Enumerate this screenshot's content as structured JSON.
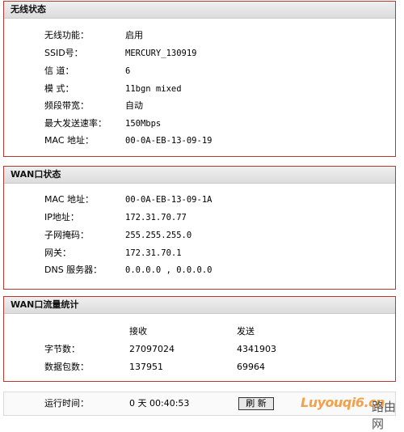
{
  "wireless": {
    "title": "无线状态",
    "rows": [
      {
        "label": "无线功能：",
        "value": "启用"
      },
      {
        "label": "SSID号：",
        "value": "MERCURY_130919"
      },
      {
        "label": "信 道：",
        "value": "6"
      },
      {
        "label": "模 式：",
        "value": "11bgn mixed"
      },
      {
        "label": "频段带宽：",
        "value": "自动"
      },
      {
        "label": "最大发送速率：",
        "value": "150Mbps"
      },
      {
        "label": "MAC 地址：",
        "value": "00-0A-EB-13-09-19"
      }
    ]
  },
  "wan": {
    "title": "WAN口状态",
    "rows": [
      {
        "label": "MAC 地址：",
        "value": "00-0A-EB-13-09-1A"
      },
      {
        "label": "IP地址：",
        "value": "172.31.70.77"
      },
      {
        "label": "子网掩码：",
        "value": "255.255.255.0"
      },
      {
        "label": "网关：",
        "value": "172.31.70.1"
      },
      {
        "label": "DNS 服务器：",
        "value": "0.0.0.0 , 0.0.0.0"
      }
    ]
  },
  "traffic": {
    "title": "WAN口流量统计",
    "col_receive": "接收",
    "col_send": "发送",
    "rows": [
      {
        "label": "字节数：",
        "receive": "27097024",
        "send": "4341903"
      },
      {
        "label": "数据包数：",
        "receive": "137951",
        "send": "69964"
      }
    ]
  },
  "uptime": {
    "label": "运行时间：",
    "value": "0 天 00:40:53",
    "refresh_label": "刷 新"
  },
  "watermark": {
    "en": "Luyouqi6.cn",
    "cn": "路由网"
  }
}
